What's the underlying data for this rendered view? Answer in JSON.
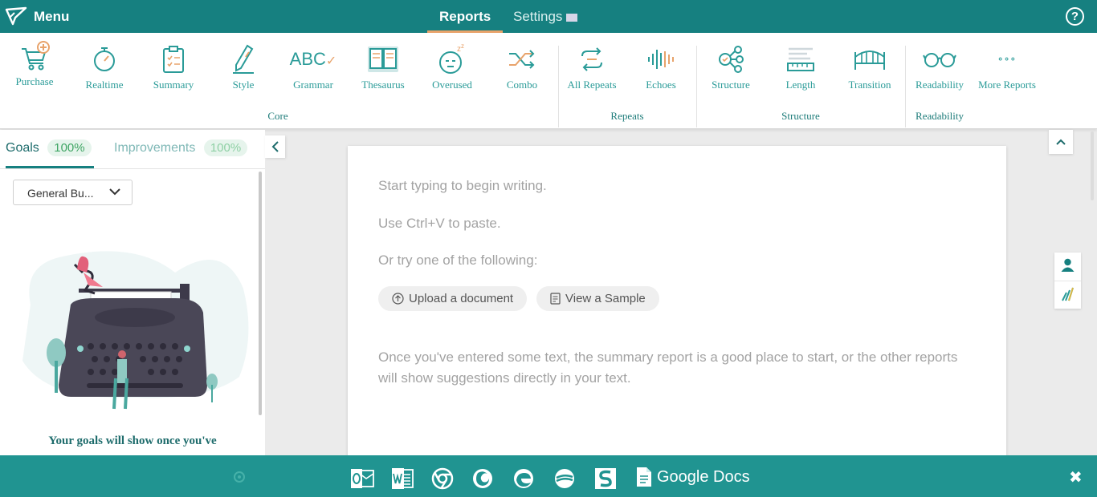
{
  "topbar": {
    "menu_label": "Menu",
    "tabs": [
      {
        "label": "Reports",
        "active": true
      },
      {
        "label": "Settings",
        "active": false
      }
    ],
    "help_label": "?"
  },
  "ribbon": {
    "purchase": "Purchase",
    "core": [
      "Realtime",
      "Summary",
      "Style",
      "Grammar",
      "Thesaurus",
      "Overused",
      "Combo"
    ],
    "repeats": [
      "All Repeats",
      "Echoes"
    ],
    "structure": [
      "Structure",
      "Length",
      "Transition"
    ],
    "readability": [
      "Readability",
      "More Reports"
    ],
    "groups": {
      "core": "Core",
      "repeats": "Repeats",
      "structure": "Structure",
      "readability": "Readability"
    },
    "grammar_icon_text": "ABC"
  },
  "left_panel": {
    "tabs": [
      {
        "label": "Goals",
        "value": "100%"
      },
      {
        "label": "Improvements",
        "value": "100%"
      }
    ],
    "dropdown_value": "General Bu...",
    "goals_message": "Your goals will show once you've"
  },
  "document": {
    "lines": [
      "Start typing to begin writing.",
      "Use Ctrl+V to paste.",
      "Or try one of the following:"
    ],
    "buttons": {
      "upload": "Upload a document",
      "sample": "View a Sample"
    },
    "hint": "Once you've entered some text, the summary report is a good place to start, or the other reports will show suggestions directly in your text."
  },
  "bottombar": {
    "integrations": [
      "outlook-icon",
      "word-icon",
      "chrome-icon",
      "firefox-icon",
      "edge-icon",
      "scrivener-icon",
      "scrivener-s-icon"
    ],
    "google_docs_label": "Google Docs",
    "close_label": "✖"
  },
  "colors": {
    "brand": "#168080",
    "accent": "#e8a36b",
    "text_teal": "#2a9b98",
    "bottom": "#209491"
  }
}
